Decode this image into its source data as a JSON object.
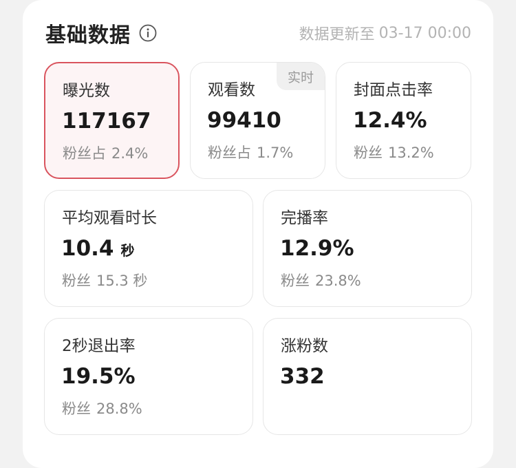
{
  "header": {
    "title": "基础数据",
    "info_icon": "info-circle-icon",
    "update_prefix": "数据更新至",
    "update_time": "03-17 00:00"
  },
  "colors": {
    "selected_border": "#d9535d",
    "selected_bg": "#fdf4f5",
    "card_border": "#e6e6e6",
    "muted_text": "#8a8a8a"
  },
  "cards": [
    {
      "label": "曝光数",
      "value": "117167",
      "unit": "",
      "sub_prefix": "粉丝占",
      "sub_value": "2.4%",
      "selected": true,
      "tag": ""
    },
    {
      "label": "观看数",
      "value": "99410",
      "unit": "",
      "sub_prefix": "粉丝占",
      "sub_value": "1.7%",
      "selected": false,
      "tag": "实时"
    },
    {
      "label": "封面点击率",
      "value": "12.4%",
      "unit": "",
      "sub_prefix": "粉丝",
      "sub_value": "13.2%",
      "selected": false,
      "tag": ""
    },
    {
      "label": "平均观看时长",
      "value": "10.4",
      "unit": "秒",
      "sub_prefix": "粉丝",
      "sub_value": "15.3 秒",
      "selected": false,
      "tag": ""
    },
    {
      "label": "完播率",
      "value": "12.9%",
      "unit": "",
      "sub_prefix": "粉丝",
      "sub_value": "23.8%",
      "selected": false,
      "tag": ""
    },
    {
      "label": "2秒退出率",
      "value": "19.5%",
      "unit": "",
      "sub_prefix": "粉丝",
      "sub_value": "28.8%",
      "selected": false,
      "tag": ""
    },
    {
      "label": "涨粉数",
      "value": "332",
      "unit": "",
      "sub_prefix": "",
      "sub_value": "",
      "selected": false,
      "tag": ""
    }
  ]
}
